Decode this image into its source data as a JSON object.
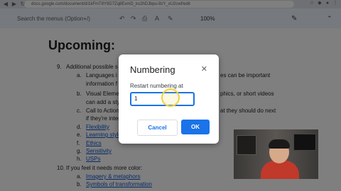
{
  "browser": {
    "url": "docs.google.com/document/d/1kFmT8Y9D7Zq8ExmD_ks2hDJbpu-9zY_xU2cwf/edit"
  },
  "toolbar": {
    "search_menus": "Search the menus (Option+/)",
    "zoom": "100%"
  },
  "document": {
    "heading": "Upcoming:",
    "lines": [
      {
        "num": "9.",
        "text": "Additional possible s"
      },
      {
        "num": "a.",
        "text": "Languages i"
      },
      {
        "num": "",
        "text": "information f"
      },
      {
        "num": "b.",
        "text": "Visual Eleme"
      },
      {
        "num": "",
        "text": "can add a sty"
      },
      {
        "num": "c.",
        "text": "Call to Action"
      },
      {
        "num": "",
        "text": "if they're inter"
      },
      {
        "num": "d.",
        "text": "Flexibility",
        "link": true
      },
      {
        "num": "e.",
        "text": "Learning style",
        "link": true
      },
      {
        "num": "f.",
        "text": "Ethics",
        "link": true
      },
      {
        "num": "g.",
        "text": "Sensitivity",
        "link": true
      },
      {
        "num": "h.",
        "text": "USPs",
        "link": true
      },
      {
        "num": "10.",
        "text": "If you feel it needs more  color:"
      },
      {
        "num": "a.",
        "text": "Imagery & metaphors",
        "link": true
      },
      {
        "num": "b.",
        "text": "Symbols of transformation",
        "link": true
      }
    ],
    "right_fragments": [
      "es can be important",
      "phics, or short videos",
      "at they should do next"
    ]
  },
  "dialog": {
    "title": "Numbering",
    "label": "Restart numbering at",
    "input_value": "1",
    "cancel": "Cancel",
    "ok": "OK"
  },
  "colors": {
    "accent": "#1a73e8",
    "overlay": "#000000"
  }
}
